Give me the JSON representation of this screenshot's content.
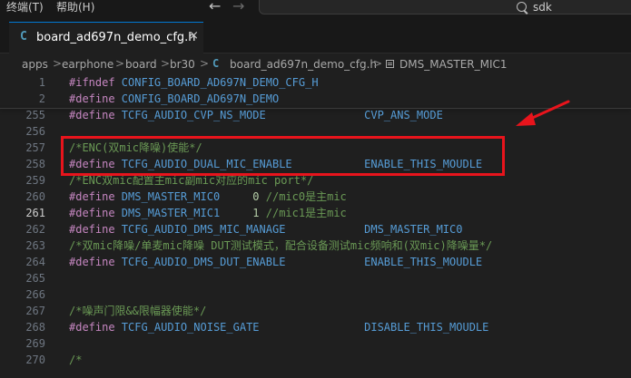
{
  "menu": {
    "terminal": "终端(T)",
    "help": "帮助(H)"
  },
  "nav": {
    "back": "←",
    "forward": "→"
  },
  "search": {
    "text": "sdk"
  },
  "tab": {
    "icon_letter": "C",
    "label": "board_ad697n_demo_cfg.h",
    "close": "×"
  },
  "breadcrumb": {
    "items": [
      "apps",
      "earphone",
      "board",
      "br30",
      "board_ad697n_demo_cfg.h",
      "DMS_MASTER_MIC1"
    ],
    "separator": ">",
    "icon_letter": "C"
  },
  "editor": {
    "active_line": "261",
    "lines": [
      {
        "num": "1",
        "tokens": [
          {
            "t": "#ifndef",
            "c": "kw"
          },
          {
            "t": " CONFIG_BOARD_AD697N_DEMO_CFG_H",
            "c": "mac"
          }
        ]
      },
      {
        "num": "2",
        "tokens": [
          {
            "t": "#define",
            "c": "kw"
          },
          {
            "t": " CONFIG_BOARD_AD697N_DEMO",
            "c": "mac"
          }
        ]
      },
      {
        "num": "255",
        "tokens": [
          {
            "t": "#define",
            "c": "kw"
          },
          {
            "t": " TCFG_AUDIO_CVP_NS_MODE               CVP_ANS_MODE",
            "c": "mac"
          }
        ]
      },
      {
        "num": "256",
        "tokens": []
      },
      {
        "num": "257",
        "tokens": [
          {
            "t": "/*ENC(双mic降噪)使能*/",
            "c": "cm"
          }
        ]
      },
      {
        "num": "258",
        "tokens": [
          {
            "t": "#define",
            "c": "kw"
          },
          {
            "t": " TCFG_AUDIO_DUAL_MIC_ENABLE           ENABLE_THIS_MOUDLE",
            "c": "mac"
          }
        ]
      },
      {
        "num": "259",
        "tokens": [
          {
            "t": "/*ENC双mic配置主mic副mic对应的mic port*/",
            "c": "cm"
          }
        ]
      },
      {
        "num": "260",
        "tokens": [
          {
            "t": "#define",
            "c": "kw"
          },
          {
            "t": " DMS_MASTER_MIC0",
            "c": "mac"
          },
          {
            "t": "     ",
            "c": ""
          },
          {
            "t": "0",
            "c": "num"
          },
          {
            "t": " //mic0是主mic",
            "c": "cm"
          }
        ]
      },
      {
        "num": "261",
        "tokens": [
          {
            "t": "#define",
            "c": "kw"
          },
          {
            "t": " DMS_MASTER_MIC1",
            "c": "mac"
          },
          {
            "t": "     ",
            "c": ""
          },
          {
            "t": "1",
            "c": "num"
          },
          {
            "t": " //mic1是主mic",
            "c": "cm"
          }
        ]
      },
      {
        "num": "262",
        "tokens": [
          {
            "t": "#define",
            "c": "kw"
          },
          {
            "t": " TCFG_AUDIO_DMS_MIC_MANAGE            DMS_MASTER_MIC0",
            "c": "mac"
          }
        ]
      },
      {
        "num": "263",
        "tokens": [
          {
            "t": "/*双mic降噪/单麦mic降噪 DUT测试模式，配合设备测试mic频响和(双mic)降噪量*/",
            "c": "cm"
          }
        ]
      },
      {
        "num": "264",
        "tokens": [
          {
            "t": "#define",
            "c": "kw"
          },
          {
            "t": " TCFG_AUDIO_DMS_DUT_ENABLE            ENABLE_THIS_MOUDLE",
            "c": "mac"
          }
        ]
      },
      {
        "num": "265",
        "tokens": []
      },
      {
        "num": "266",
        "tokens": []
      },
      {
        "num": "267",
        "tokens": [
          {
            "t": "/*噪声门限&&限幅器使能*/",
            "c": "cm"
          }
        ]
      },
      {
        "num": "268",
        "tokens": [
          {
            "t": "#define",
            "c": "kw"
          },
          {
            "t": " TCFG_AUDIO_NOISE_GATE                DISABLE_THIS_MOUDLE",
            "c": "mac"
          }
        ]
      },
      {
        "num": "269",
        "tokens": []
      },
      {
        "num": "270",
        "tokens": [
          {
            "t": "/*",
            "c": "cm"
          }
        ]
      }
    ]
  },
  "colors": {
    "keyword": "#c586c0",
    "macro": "#569cd6",
    "number": "#b5cea8",
    "comment": "#6a9955",
    "annotation": "#e8141c",
    "tab_accent": "#0078d4"
  }
}
